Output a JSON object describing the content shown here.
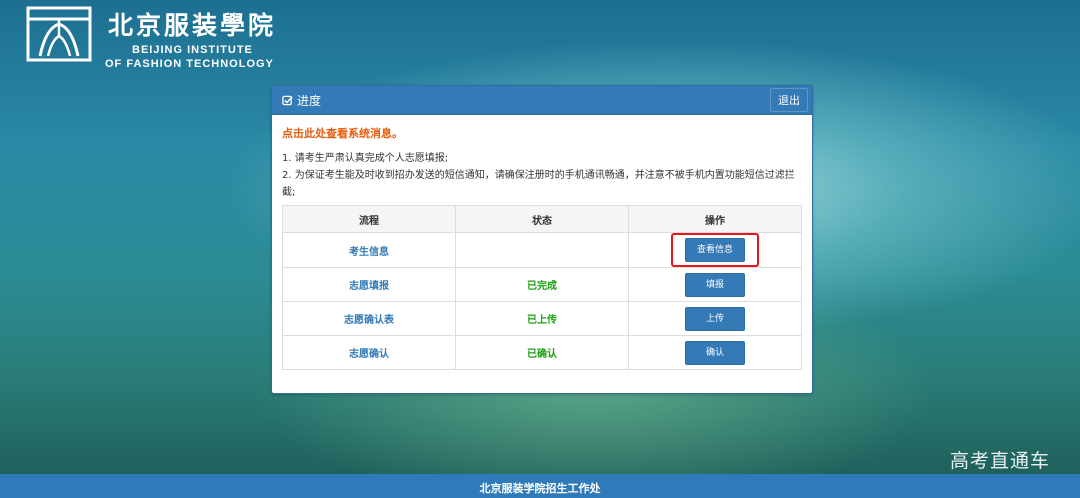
{
  "header": {
    "logo_cn": "北京服装學院",
    "logo_en_line1": "BEIJING INSTITUTE",
    "logo_en_line2": "OF FASHION TECHNOLOGY"
  },
  "panel": {
    "title": "进度",
    "logout_label": "退出",
    "system_message_link": "点击此处查看系统消息。",
    "notices": [
      "1. 请考生严肃认真完成个人志愿填报;",
      "2. 为保证考生能及时收到招办发送的短信通知，请确保注册时的手机通讯畅通，并注意不被手机内置功能短信过滤拦截;"
    ],
    "table": {
      "headers": [
        "流程",
        "状态",
        "操作"
      ],
      "rows": [
        {
          "step": "考生信息",
          "status": "",
          "action": "查看信息"
        },
        {
          "step": "志愿填报",
          "status": "已完成",
          "action": "填报"
        },
        {
          "step": "志愿确认表",
          "status": "已上传",
          "action": "上传"
        },
        {
          "step": "志愿确认",
          "status": "已确认",
          "action": "确认"
        }
      ]
    }
  },
  "watermark": "高考直通车",
  "footer": "北京服装学院招生工作处",
  "colors": {
    "primary": "#337ab7",
    "status_green": "#1da012",
    "message_orange": "#e85c0d",
    "highlight_red": "#e8141b"
  }
}
